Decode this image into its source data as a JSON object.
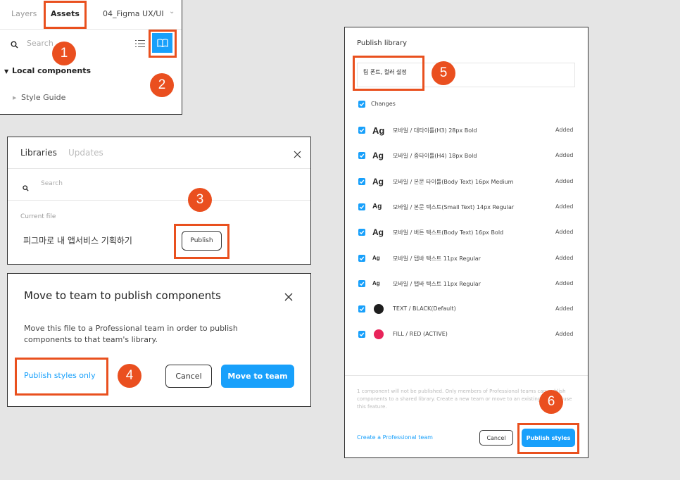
{
  "assets_panel": {
    "tabs": [
      "Layers",
      "Assets",
      "04_Figma UX/UI"
    ],
    "search_placeholder": "Search",
    "section_label": "Local components",
    "item_label": "Style Guide"
  },
  "libraries_panel": {
    "title": "Libraries",
    "tab_updates": "Updates",
    "search_placeholder": "Search",
    "current_file_label": "Current file",
    "file_name": "피그마로 내 앱서비스 기획하기",
    "publish_label": "Publish"
  },
  "move_dialog": {
    "title": "Move to team to publish components",
    "body": "Move this file to a Professional team in order to publish components to that team's library.",
    "publish_styles_only": "Publish styles only",
    "cancel_label": "Cancel",
    "move_label": "Move to team"
  },
  "publish_panel": {
    "title": "Publish library",
    "description_value": "팀 폰트, 컬러 설정",
    "changes_label": "Changes",
    "styles": [
      {
        "icon": "Ag",
        "label": "모바일 / 대타이틀(H3) 28px Bold",
        "status": "Added"
      },
      {
        "icon": "Ag",
        "label": "모바일 / 중타이틀(H4) 18px Bold",
        "status": "Added"
      },
      {
        "icon": "Ag",
        "label": "모바일 / 본문 타이틀(Body Text) 16px Medium",
        "status": "Added"
      },
      {
        "icon": "Ag",
        "label": "모바일 / 본문 텍스트(Small Text) 14px Regular",
        "status": "Added"
      },
      {
        "icon": "Ag",
        "label": "모바일 / 버튼 텍스트(Body Text) 16px Bold",
        "status": "Added"
      },
      {
        "icon": "Ag",
        "label": "모바일 / 탭바 텍스트 11px Regular",
        "status": "Added"
      },
      {
        "icon": "Ag",
        "label": "모바일 / 탭바 텍스트 11px Regular",
        "status": "Added"
      },
      {
        "icon": "",
        "label": "TEXT / BLACK(Default)",
        "status": "Added",
        "swatch": "#1e1e1e"
      },
      {
        "icon": "",
        "label": "FILL / RED (ACTIVE)",
        "status": "Added",
        "swatch": "#e8245a"
      }
    ],
    "footer_note": "1 component will not be published. Only members of Professional teams can publish components to a shared library. Create a new team or move to an existing team to use this feature.",
    "create_team_link": "Create a Professional team",
    "cancel_label": "Cancel",
    "publish_styles_label": "Publish styles"
  },
  "steps": [
    "1",
    "2",
    "3",
    "4",
    "5",
    "6"
  ],
  "colors": {
    "accent": "#18a0fb",
    "highlight": "#e9501e",
    "step_badge": "#ea4f1f"
  }
}
